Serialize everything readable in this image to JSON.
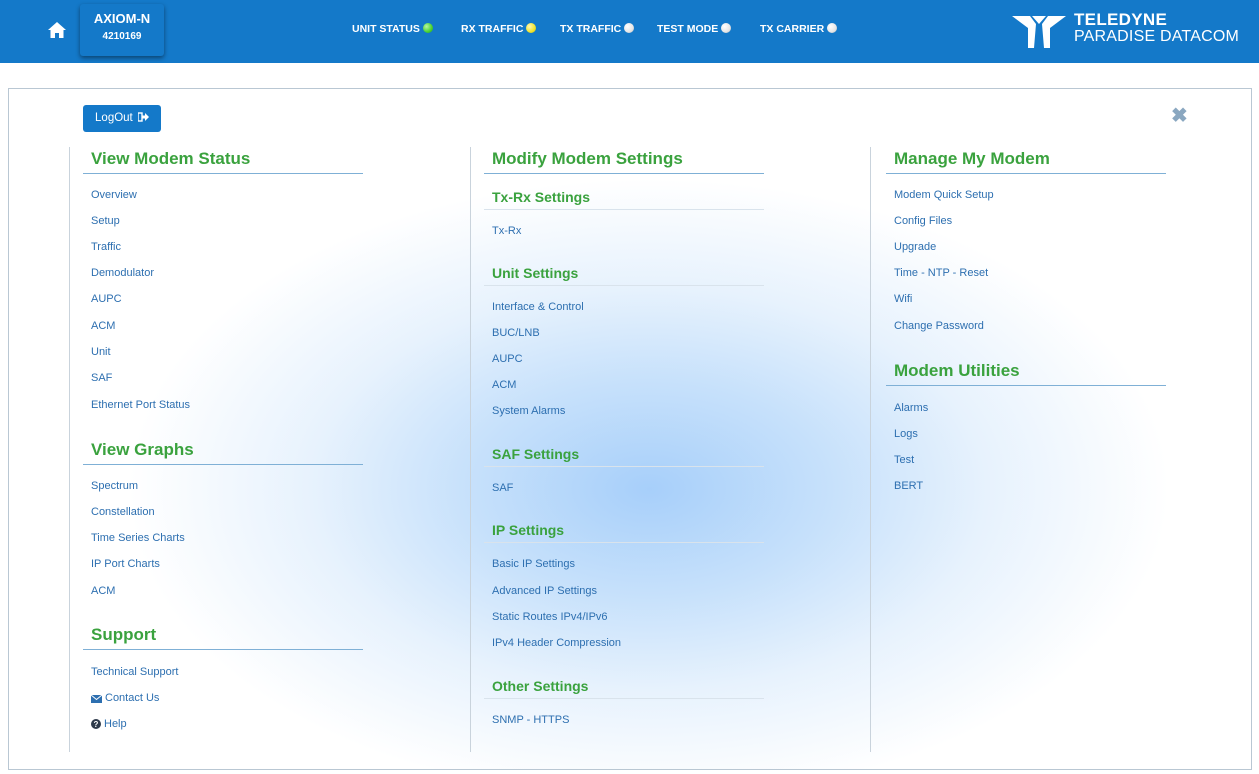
{
  "header": {
    "device_name": "AXIOM-N",
    "device_serial": "4210169",
    "indicators": [
      {
        "label": "UNIT STATUS",
        "color": "#47d12f"
      },
      {
        "label": "RX TRAFFIC",
        "color": "#f0e32b"
      },
      {
        "label": "TX TRAFFIC",
        "color": "#e6e6e6"
      },
      {
        "label": "TEST MODE",
        "color": "#e6e6e6"
      },
      {
        "label": "TX CARRIER",
        "color": "#e6e6e6"
      }
    ],
    "logo_line1": "TELEDYNE",
    "logo_line2": "PARADISE DATACOM",
    "brand_color": "#1479c9"
  },
  "panel": {
    "logout_label": "LogOut",
    "close_label": "✖"
  },
  "col1": {
    "view_status": {
      "title": "View Modem Status",
      "items": [
        "Overview",
        "Setup",
        "Traffic",
        "Demodulator",
        "AUPC",
        "ACM",
        "Unit",
        "SAF",
        "Ethernet Port Status"
      ]
    },
    "view_graphs": {
      "title": "View Graphs",
      "items": [
        "Spectrum",
        "Constellation",
        "Time Series Charts",
        "IP Port Charts",
        "ACM"
      ]
    },
    "support": {
      "title": "Support",
      "items": [
        "Technical Support",
        "Contact Us",
        "Help"
      ]
    }
  },
  "col2": {
    "title": "Modify Modem Settings",
    "txrx": {
      "title": "Tx-Rx Settings",
      "items": [
        "Tx-Rx"
      ]
    },
    "unit": {
      "title": "Unit Settings",
      "items": [
        "Interface & Control",
        "BUC/LNB",
        "AUPC",
        "ACM",
        "System Alarms"
      ]
    },
    "saf": {
      "title": "SAF Settings",
      "items": [
        "SAF"
      ]
    },
    "ip": {
      "title": "IP Settings",
      "items": [
        "Basic IP Settings",
        "Advanced IP Settings",
        "Static Routes IPv4/IPv6",
        "IPv4 Header Compression"
      ]
    },
    "other": {
      "title": "Other Settings",
      "items": [
        "SNMP - HTTPS"
      ]
    }
  },
  "col3": {
    "manage": {
      "title": "Manage My Modem",
      "items": [
        "Modem Quick Setup",
        "Config Files",
        "Upgrade",
        "Time - NTP - Reset",
        "Wifi",
        "Change Password"
      ]
    },
    "utilities": {
      "title": "Modem Utilities",
      "items": [
        "Alarms",
        "Logs",
        "Test",
        "BERT"
      ]
    }
  }
}
